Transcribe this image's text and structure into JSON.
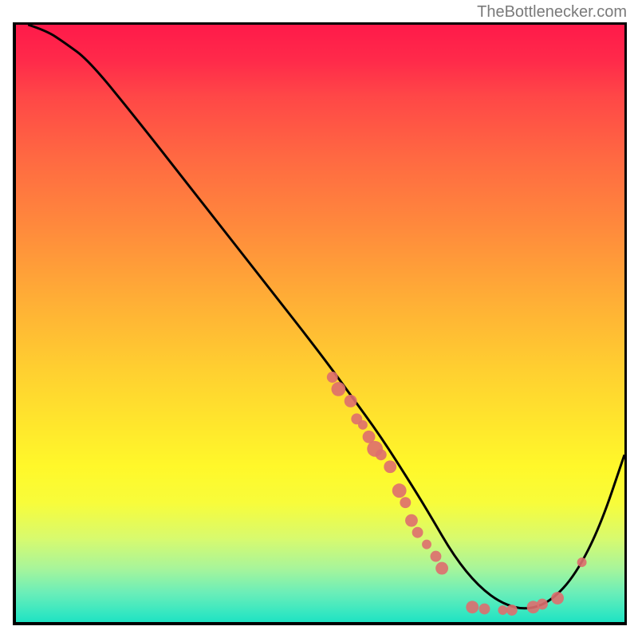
{
  "watermark": "TheBottlenecker.com",
  "chart_data": {
    "type": "line",
    "title": "",
    "xlabel": "",
    "ylabel": "",
    "xlim": [
      0,
      100
    ],
    "ylim": [
      0,
      100
    ],
    "series": [
      {
        "name": "curve",
        "x": [
          2,
          5,
          8,
          12,
          20,
          30,
          40,
          50,
          55,
          60,
          65,
          68,
          72,
          76,
          80,
          84,
          88,
          92,
          96,
          100
        ],
        "y": [
          100,
          99,
          97,
          94,
          84,
          71,
          58,
          45,
          38,
          31,
          23,
          18,
          11,
          6,
          3,
          2,
          3.5,
          8,
          16,
          28
        ]
      }
    ],
    "scatter": [
      {
        "x": 52,
        "y": 41,
        "r": 7
      },
      {
        "x": 53,
        "y": 39,
        "r": 9
      },
      {
        "x": 55,
        "y": 37,
        "r": 8
      },
      {
        "x": 56,
        "y": 34,
        "r": 7
      },
      {
        "x": 57,
        "y": 33,
        "r": 6
      },
      {
        "x": 58,
        "y": 31,
        "r": 8
      },
      {
        "x": 59,
        "y": 29,
        "r": 10
      },
      {
        "x": 60,
        "y": 28,
        "r": 7
      },
      {
        "x": 61.5,
        "y": 26,
        "r": 8
      },
      {
        "x": 63,
        "y": 22,
        "r": 9
      },
      {
        "x": 64,
        "y": 20,
        "r": 7
      },
      {
        "x": 65,
        "y": 17,
        "r": 8
      },
      {
        "x": 66,
        "y": 15,
        "r": 7
      },
      {
        "x": 67.5,
        "y": 13,
        "r": 6
      },
      {
        "x": 69,
        "y": 11,
        "r": 7
      },
      {
        "x": 70,
        "y": 9,
        "r": 8
      },
      {
        "x": 75,
        "y": 2.5,
        "r": 8
      },
      {
        "x": 77,
        "y": 2.2,
        "r": 7
      },
      {
        "x": 80,
        "y": 2.0,
        "r": 6
      },
      {
        "x": 81.5,
        "y": 2.0,
        "r": 7
      },
      {
        "x": 85,
        "y": 2.5,
        "r": 8
      },
      {
        "x": 86.5,
        "y": 3.0,
        "r": 7
      },
      {
        "x": 89,
        "y": 4.0,
        "r": 8
      },
      {
        "x": 93,
        "y": 10,
        "r": 6
      }
    ],
    "colors": {
      "line": "#000000",
      "scatter": "#de6e6e"
    }
  }
}
